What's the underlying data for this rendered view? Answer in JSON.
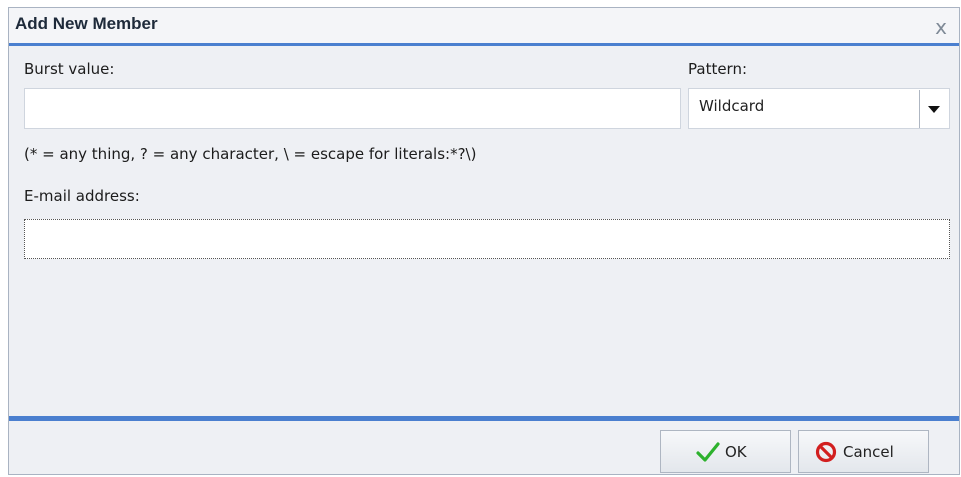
{
  "dialog": {
    "title": "Add New Member",
    "close_glyph": "x"
  },
  "form": {
    "burst_label": "Burst value:",
    "burst_value": "",
    "pattern_label": "Pattern:",
    "pattern_value": "Wildcard",
    "hint": "(* = any thing, ? = any character, \\ = escape for literals:*?\\)",
    "email_label": "E-mail address:",
    "email_value": ""
  },
  "buttons": {
    "ok_label": "OK",
    "cancel_label": "Cancel"
  },
  "colors": {
    "accent": "#4a7fcf",
    "ok_check": "#2db12d",
    "cancel_icon": "#d21f1f"
  },
  "icons": {
    "close": "close-icon",
    "dropdown": "chevron-down-icon",
    "ok": "checkmark-icon",
    "cancel": "no-entry-icon"
  }
}
